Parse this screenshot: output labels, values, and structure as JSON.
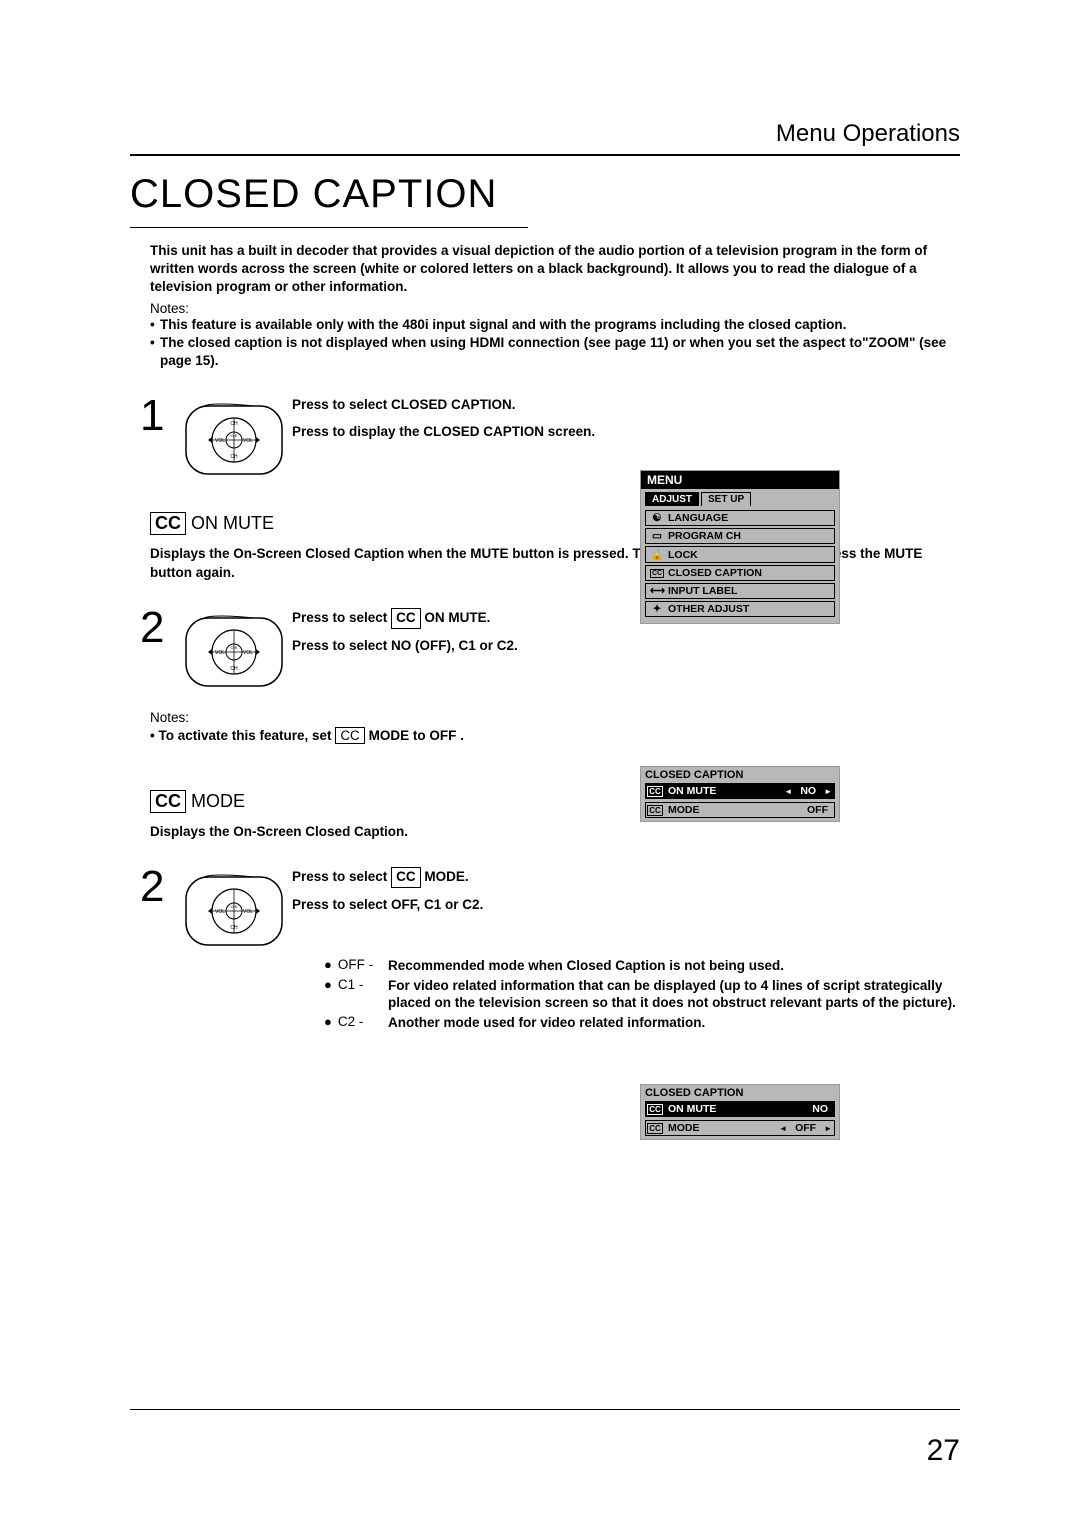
{
  "header": "Menu Operations",
  "title": "CLOSED CAPTION",
  "intro": "This unit has a built in decoder that provides a visual depiction of the audio portion of a television program in the form of written words across the screen (white or colored letters on a black background). It allows you to read the dialogue of a television program or other information.",
  "notes_label": "Notes:",
  "intro_notes": [
    "This feature is available only with the 480i input signal and with the programs including the closed caption.",
    "The closed caption is not displayed when using HDMI connection (see page 11) or when you set the aspect to\"ZOOM\" (see page 15)."
  ],
  "step1": {
    "num": "1",
    "line1": "Press to select CLOSED CAPTION.",
    "line2": "Press to display the CLOSED CAPTION screen."
  },
  "menu": {
    "title": "MENU",
    "tab_adjust": "ADJUST",
    "tab_setup": "SET  UP",
    "items": [
      {
        "icon": "☯",
        "label": "LANGUAGE"
      },
      {
        "icon": "▭",
        "label": "PROGRAM  CH"
      },
      {
        "icon": "🔒",
        "label": "LOCK"
      },
      {
        "icon": "CC",
        "label": "CLOSED  CAPTION"
      },
      {
        "icon": "⟷",
        "label": "INPUT  LABEL"
      },
      {
        "icon": "✦",
        "label": "OTHER  ADJUST"
      }
    ]
  },
  "cc_on_mute": {
    "heading_box": "CC",
    "heading_text": " ON MUTE",
    "desc": "Displays the On-Screen Closed Caption when the MUTE button is pressed. To delete the closed caption, press the MUTE button again.",
    "step_num": "2",
    "line1_a": "Press to select",
    "line1_box": "CC",
    "line1_b": "ON MUTE.",
    "line2": "Press to select NO (OFF), C1 or C2.",
    "sub_notes_label": "Notes:",
    "sub_note_a": "• To activate this feature, set",
    "sub_note_box": " CC ",
    "sub_note_b": " MODE to OFF ."
  },
  "cc_panel1": {
    "title": "CLOSED  CAPTION",
    "row1_icon": "CC",
    "row1_label": "ON MUTE",
    "row1_val": "NO",
    "row2_icon": "CC",
    "row2_label": "MODE",
    "row2_val": "OFF"
  },
  "cc_mode": {
    "heading_box": "CC",
    "heading_text": " MODE",
    "desc": "Displays the On-Screen Closed Caption.",
    "step_num": "2",
    "line1_a": "Press to select",
    "line1_box": "CC",
    "line1_b": "MODE.",
    "line2": "Press to select OFF, C1 or C2."
  },
  "cc_panel2": {
    "title": "CLOSED  CAPTION",
    "row1_icon": "CC",
    "row1_label": "ON MUTE",
    "row1_val": "NO",
    "row2_icon": "CC",
    "row2_label": "MODE",
    "row2_val": "OFF"
  },
  "mode_defs": [
    {
      "label": "OFF",
      "text": "Recommended mode when Closed Caption is not being used."
    },
    {
      "label": "C1",
      "text": "For video related information that can be displayed (up to 4 lines of script strategically placed on the television screen so that it does not obstruct relevant parts of the picture)."
    },
    {
      "label": "C2",
      "text": "Another mode used for video related information."
    }
  ],
  "page_number": "27"
}
